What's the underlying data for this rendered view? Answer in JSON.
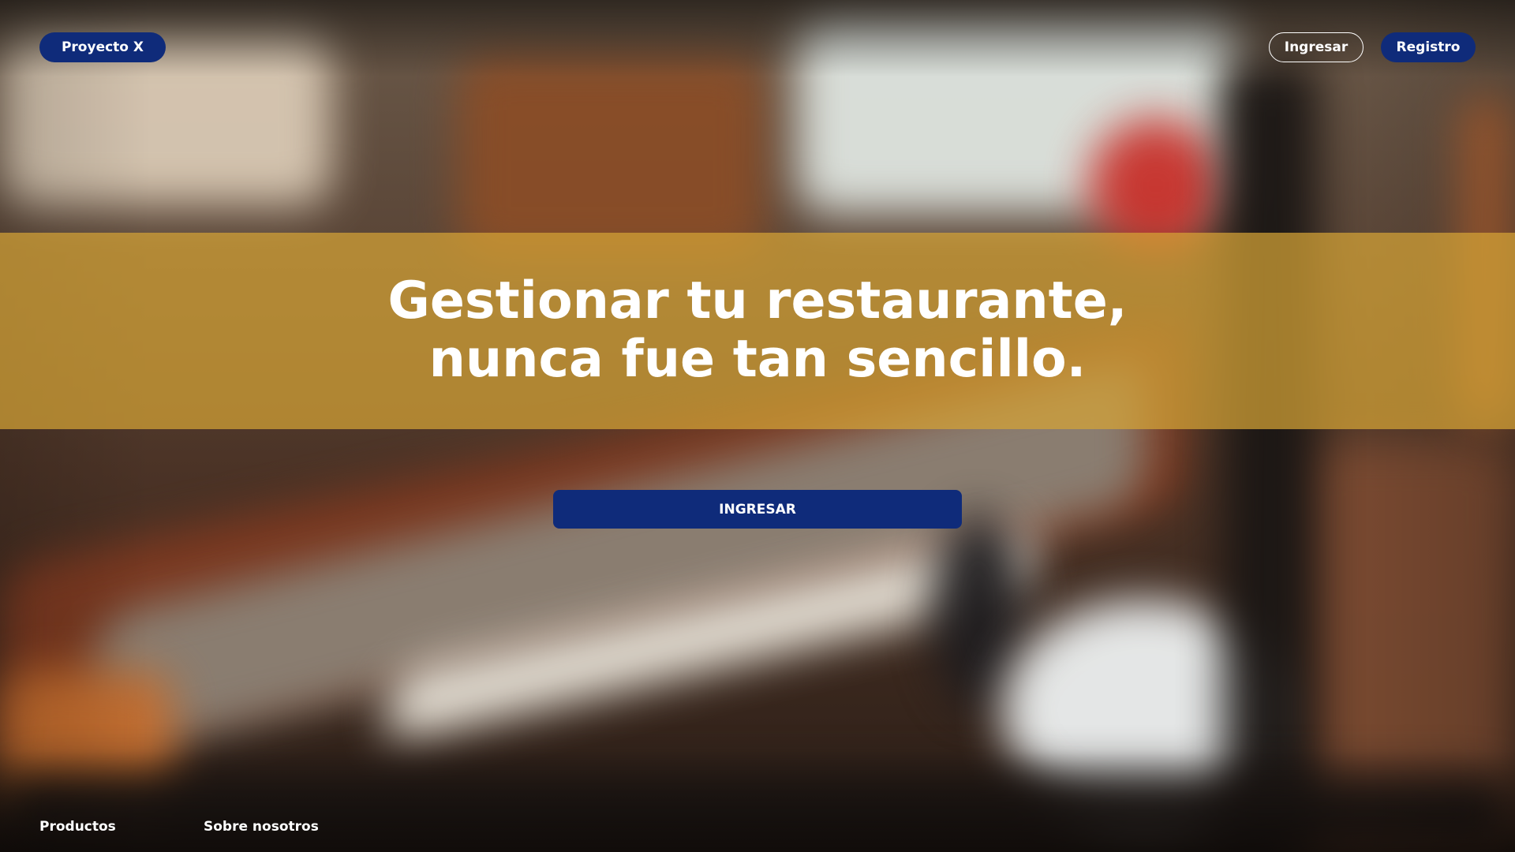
{
  "brand": {
    "label": "Proyecto X"
  },
  "nav": {
    "login_label": "Ingresar",
    "register_label": "Registro"
  },
  "hero": {
    "line1": "Gestionar tu restaurante,",
    "line2": "nunca fue tan sencillo.",
    "cta_label": "INGRESAR"
  },
  "footer": {
    "products_label": "Productos",
    "about_label": "Sobre nosotros"
  },
  "colors": {
    "navy": "#0f2b7a",
    "band": "#d6a336",
    "text": "#ffffff"
  }
}
